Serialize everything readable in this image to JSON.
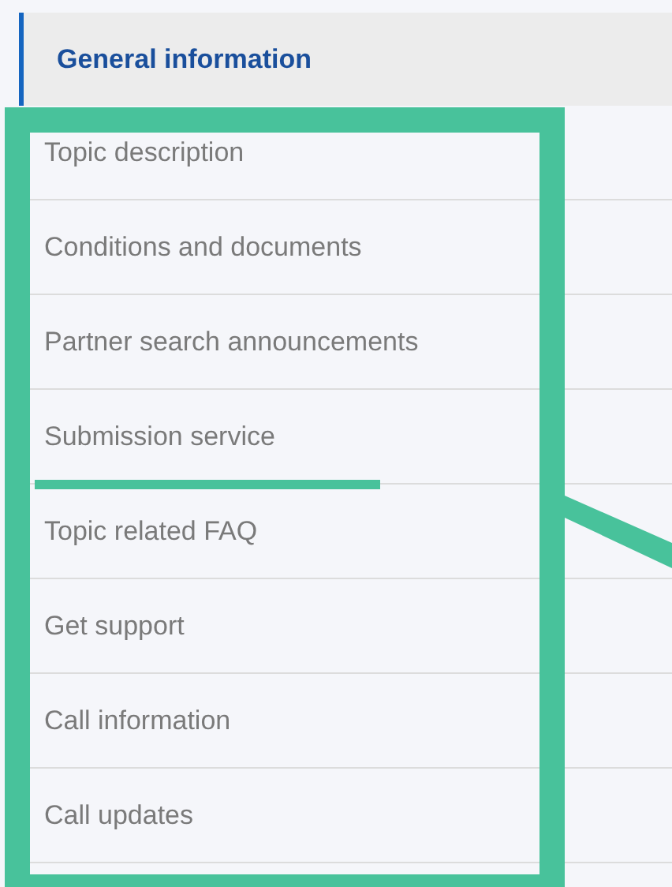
{
  "section": {
    "title": "General information",
    "selected": true
  },
  "items": [
    {
      "label": "Topic description",
      "underlined": false
    },
    {
      "label": "Conditions and documents",
      "underlined": false
    },
    {
      "label": "Partner search announcements",
      "underlined": false
    },
    {
      "label": "Submission service",
      "underlined": true
    },
    {
      "label": "Topic related FAQ",
      "underlined": false
    },
    {
      "label": "Get support",
      "underlined": false
    },
    {
      "label": "Call information",
      "underlined": false
    },
    {
      "label": "Call updates",
      "underlined": false
    }
  ]
}
